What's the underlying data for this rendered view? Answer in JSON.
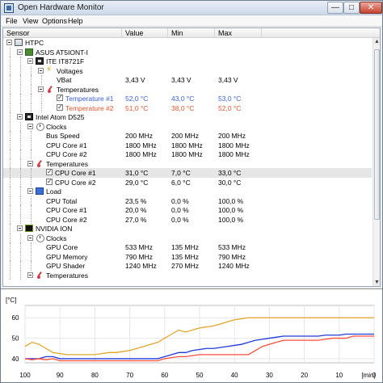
{
  "window": {
    "title": "Open Hardware Monitor",
    "buttons": {
      "minimize": "—",
      "maximize": "□",
      "close": "✕"
    }
  },
  "menu": [
    "File",
    "View",
    "Options",
    "Help"
  ],
  "columns": {
    "sensor": "Sensor",
    "value": "Value",
    "min": "Min",
    "max": "Max"
  },
  "tree": [
    {
      "name": "hardware-htpc",
      "label": "HTPC",
      "value": "",
      "min": "",
      "max": "",
      "level": 0,
      "icon": "computer-icon",
      "expander": true
    },
    {
      "name": "hardware-asus-board",
      "label": "ASUS AT5IONT-I",
      "value": "",
      "min": "",
      "max": "",
      "level": 1,
      "icon": "motherboard-icon",
      "expander": true
    },
    {
      "name": "hardware-ite-chip",
      "label": "ITE IT8721F",
      "value": "",
      "min": "",
      "max": "",
      "level": 2,
      "icon": "chip-icon",
      "expander": true
    },
    {
      "name": "group-voltages",
      "label": "Voltages",
      "value": "",
      "min": "",
      "max": "",
      "level": 3,
      "icon": "voltage-icon",
      "expander": true
    },
    {
      "name": "sensor-vbat",
      "label": "VBat",
      "value": "3,43 V",
      "min": "3,43 V",
      "max": "3,43 V",
      "level": 4
    },
    {
      "name": "group-temperatures",
      "label": "Temperatures",
      "value": "",
      "min": "",
      "max": "",
      "level": 3,
      "icon": "temperature-icon",
      "expander": true
    },
    {
      "name": "sensor-temperature-1",
      "label": "Temperature #1",
      "value": "52,0 °C",
      "min": "43,0 °C",
      "max": "53,0 °C",
      "level": 4,
      "checkbox": true,
      "color": "#3a5cd9"
    },
    {
      "name": "sensor-temperature-2",
      "label": "Temperature #2",
      "value": "51,0 °C",
      "min": "38,0 °C",
      "max": "52,0 °C",
      "level": 4,
      "checkbox": true,
      "color": "#e0562f"
    },
    {
      "name": "hardware-intel-atom",
      "label": "Intel Atom D525",
      "value": "",
      "min": "",
      "max": "",
      "level": 1,
      "icon": "cpu-icon",
      "expander": true
    },
    {
      "name": "group-clocks",
      "label": "Clocks",
      "value": "",
      "min": "",
      "max": "",
      "level": 2,
      "icon": "clock-icon",
      "expander": true
    },
    {
      "name": "sensor-bus-speed",
      "label": "Bus Speed",
      "value": "200 MHz",
      "min": "200 MHz",
      "max": "200 MHz",
      "level": 3
    },
    {
      "name": "sensor-cpu-core-1-clock",
      "label": "CPU Core #1",
      "value": "1800 MHz",
      "min": "1800 MHz",
      "max": "1800 MHz",
      "level": 3
    },
    {
      "name": "sensor-cpu-core-2-clock",
      "label": "CPU Core #2",
      "value": "1800 MHz",
      "min": "1800 MHz",
      "max": "1800 MHz",
      "level": 3
    },
    {
      "name": "group-temperatures-cpu",
      "label": "Temperatures",
      "value": "",
      "min": "",
      "max": "",
      "level": 2,
      "icon": "temperature-icon",
      "expander": true
    },
    {
      "name": "sensor-cpu-core-1-temp",
      "label": "CPU Core #1",
      "value": "31,0 °C",
      "min": "7,0 °C",
      "max": "33,0 °C",
      "level": 3,
      "checkbox": true,
      "selected": true
    },
    {
      "name": "sensor-cpu-core-2-temp",
      "label": "CPU Core #2",
      "value": "29,0 °C",
      "min": "6,0 °C",
      "max": "30,0 °C",
      "level": 3,
      "checkbox": true
    },
    {
      "name": "group-load",
      "label": "Load",
      "value": "",
      "min": "",
      "max": "",
      "level": 2,
      "icon": "load-icon",
      "expander": true
    },
    {
      "name": "sensor-cpu-total-load",
      "label": "CPU Total",
      "value": "23,5 %",
      "min": "0,0 %",
      "max": "100,0 %",
      "level": 3
    },
    {
      "name": "sensor-cpu-core-1-load",
      "label": "CPU Core #1",
      "value": "20,0 %",
      "min": "0,0 %",
      "max": "100,0 %",
      "level": 3
    },
    {
      "name": "sensor-cpu-core-2-load",
      "label": "CPU Core #2",
      "value": "27,0 %",
      "min": "0,0 %",
      "max": "100,0 %",
      "level": 3
    },
    {
      "name": "hardware-nvidia-ion",
      "label": "NVIDIA ION",
      "value": "",
      "min": "",
      "max": "",
      "level": 1,
      "icon": "gpu-icon",
      "expander": true
    },
    {
      "name": "group-clocks-gpu",
      "label": "Clocks",
      "value": "",
      "min": "",
      "max": "",
      "level": 2,
      "icon": "clock-icon",
      "expander": true
    },
    {
      "name": "sensor-gpu-core",
      "label": "GPU Core",
      "value": "533 MHz",
      "min": "135 MHz",
      "max": "533 MHz",
      "level": 3
    },
    {
      "name": "sensor-gpu-memory",
      "label": "GPU Memory",
      "value": "790 MHz",
      "min": "135 MHz",
      "max": "790 MHz",
      "level": 3
    },
    {
      "name": "sensor-gpu-shader",
      "label": "GPU Shader",
      "value": "1240 MHz",
      "min": "270 MHz",
      "max": "1240 MHz",
      "level": 3
    },
    {
      "name": "group-temperatures-gpu",
      "label": "Temperatures",
      "value": "",
      "min": "",
      "max": "",
      "level": 2,
      "icon": "temperature-icon",
      "expander": true
    }
  ],
  "plot": {
    "y_unit": "[°C]",
    "y_ticks": [
      "60",
      "50",
      "40"
    ],
    "x_ticks": [
      "100",
      "90",
      "80",
      "70",
      "60",
      "50",
      "40",
      "30",
      "20",
      "10",
      "0"
    ],
    "x_unit": "[min]",
    "colors": {
      "orange": "#e0a52b",
      "blue": "#1f3ad6",
      "red": "#ff4f3b"
    }
  }
}
